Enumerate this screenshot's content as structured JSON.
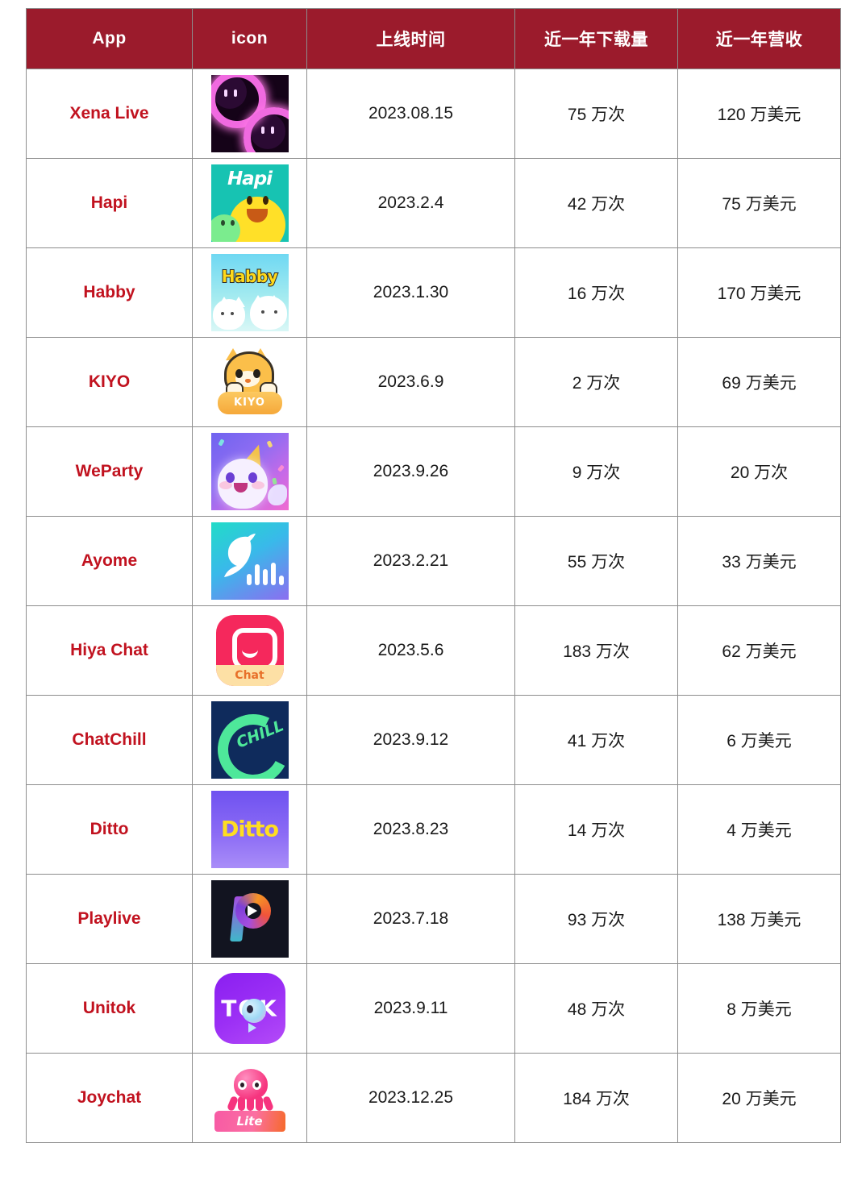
{
  "table": {
    "header_bg": "#9b1b2c",
    "header_text_color": "#ffffff",
    "app_name_color": "#c1121f",
    "border_color": "#8d8d8d",
    "columns": [
      {
        "key": "app",
        "label": "App"
      },
      {
        "key": "icon",
        "label": "icon"
      },
      {
        "key": "date",
        "label": "上线时间"
      },
      {
        "key": "downloads",
        "label": "近一年下载量"
      },
      {
        "key": "revenue",
        "label": "近一年营收"
      }
    ],
    "rows": [
      {
        "app": "Xena Live",
        "icon_name": "xena-live-app-icon",
        "date": "2023.08.15",
        "downloads": "75 万次",
        "revenue": "120 万美元"
      },
      {
        "app": "Hapi",
        "icon_name": "hapi-app-icon",
        "icon_text": "Hapi",
        "date": "2023.2.4",
        "downloads": "42 万次",
        "revenue": "75 万美元"
      },
      {
        "app": "Habby",
        "icon_name": "habby-app-icon",
        "icon_text": "Habby",
        "date": "2023.1.30",
        "downloads": "16 万次",
        "revenue": "170 万美元"
      },
      {
        "app": "KIYO",
        "icon_name": "kiyo-app-icon",
        "icon_text": "KIYO",
        "date": "2023.6.9",
        "downloads": "2 万次",
        "revenue": "69 万美元"
      },
      {
        "app": "WeParty",
        "icon_name": "weparty-app-icon",
        "date": "2023.9.26",
        "downloads": "9 万次",
        "revenue": "20 万次"
      },
      {
        "app": "Ayome",
        "icon_name": "ayome-app-icon",
        "date": "2023.2.21",
        "downloads": "55 万次",
        "revenue": "33 万美元"
      },
      {
        "app": "Hiya Chat",
        "icon_name": "hiya-chat-app-icon",
        "icon_text": "Chat",
        "date": "2023.5.6",
        "downloads": "183 万次",
        "revenue": "62 万美元"
      },
      {
        "app": "ChatChill",
        "icon_name": "chatchill-app-icon",
        "icon_text": "CHILL",
        "date": "2023.9.12",
        "downloads": "41 万次",
        "revenue": "6 万美元"
      },
      {
        "app": "Ditto",
        "icon_name": "ditto-app-icon",
        "icon_text": "Ditto",
        "date": "2023.8.23",
        "downloads": "14 万次",
        "revenue": "4 万美元"
      },
      {
        "app": "Playlive",
        "icon_name": "playlive-app-icon",
        "date": "2023.7.18",
        "downloads": "93 万次",
        "revenue": "138 万美元"
      },
      {
        "app": "Unitok",
        "icon_name": "unitok-app-icon",
        "icon_text": "TOK",
        "date": "2023.9.11",
        "downloads": "48 万次",
        "revenue": "8 万美元"
      },
      {
        "app": "Joychat",
        "icon_name": "joychat-app-icon",
        "icon_text": "Lite",
        "date": "2023.12.25",
        "downloads": "184 万次",
        "revenue": "20 万美元"
      }
    ]
  }
}
